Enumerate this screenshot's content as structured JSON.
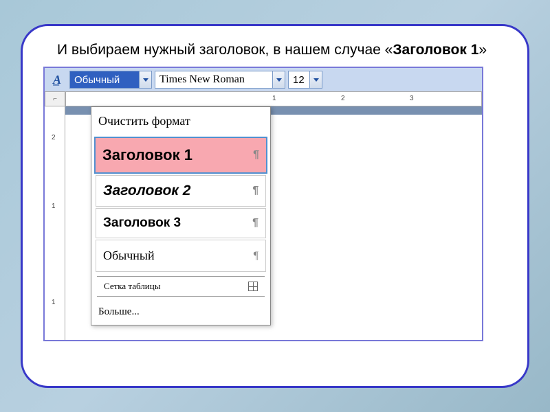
{
  "instruction": {
    "prefix": "И выбираем нужный заголовок, в нашем случае «",
    "bold": "Заголовок 1",
    "suffix": "»"
  },
  "toolbar": {
    "style_value": "Обычный",
    "font_value": "Times New Roman",
    "size_value": "12"
  },
  "ruler": {
    "h": {
      "t1": "1",
      "t2": "2",
      "t3": "3"
    },
    "v": {
      "t1": "2",
      "t2": "1",
      "t3": "1"
    },
    "corner": "⌐"
  },
  "dropdown": {
    "clear": "Очистить формат",
    "h1": "Заголовок 1",
    "h2": "Заголовок 2",
    "h3": "Заголовок 3",
    "normal": "Обычный",
    "grid": "Сетка таблицы",
    "more": "Больше..."
  },
  "glyph": {
    "pilcrow": "¶"
  }
}
